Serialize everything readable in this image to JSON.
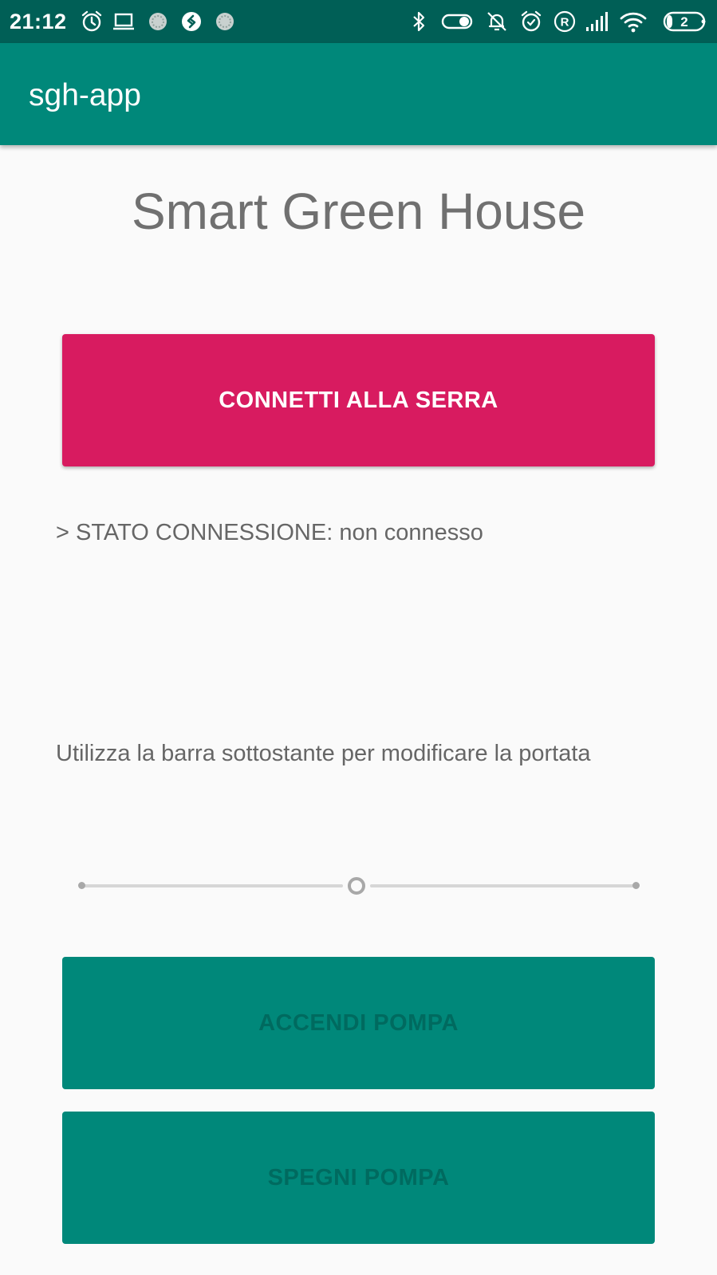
{
  "status_bar": {
    "time": "21:12",
    "battery_level": "2",
    "icons_left": [
      "alarm-icon",
      "laptop-icon",
      "app-notification-icon",
      "shazam-icon",
      "app-notification-icon"
    ],
    "icons_right": [
      "bluetooth-icon",
      "toggle-icon",
      "bell-off-icon",
      "alarm-icon",
      "roaming-icon",
      "signal-icon",
      "wifi-icon",
      "battery-icon"
    ],
    "background_color": "#005f56"
  },
  "app_bar": {
    "title": "sgh-app",
    "background_color": "#00887a"
  },
  "main": {
    "title": "Smart Green House",
    "connect_button_label": "CONNETTI ALLA SERRA",
    "connect_button_color": "#d81b60",
    "connection_status": "> STATO CONNESSIONE: non connesso",
    "slider_hint": "Utilizza la barra sottostante per modificare la portata",
    "slider": {
      "value_fraction": 0.5,
      "ticks": 3
    },
    "pump_on_label": "ACCENDI POMPA",
    "pump_off_label": "SPEGNI POMPA",
    "pump_button_color": "#00887a"
  }
}
